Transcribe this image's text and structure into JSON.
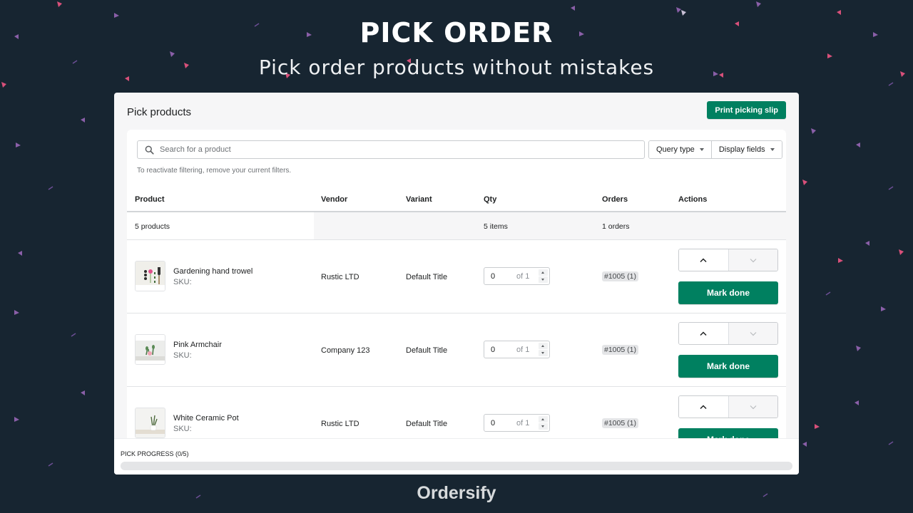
{
  "hero": {
    "title": "PICK ORDER",
    "subtitle": "Pick order products without mistakes"
  },
  "brand": "Ordersify",
  "colors": {
    "background": "#172531",
    "accent": "#008060",
    "confetti_purple": "#8a5fa8",
    "confetti_pink": "#d8507a"
  },
  "panel": {
    "title": "Pick products",
    "print_button": "Print picking slip"
  },
  "search": {
    "icon": "search-icon",
    "placeholder": "Search for a product",
    "value": ""
  },
  "filters": {
    "query_type": "Query type",
    "display_fields": "Display fields"
  },
  "hint": "To reactivate filtering, remove your current filters.",
  "table": {
    "headers": [
      "Product",
      "Vendor",
      "Variant",
      "Qty",
      "Orders",
      "Actions"
    ],
    "summary": {
      "products": "5 products",
      "items": "5 items",
      "orders": "1 orders"
    },
    "rows": [
      {
        "name": "Gardening hand trowel",
        "sku": "SKU:",
        "vendor": "Rustic LTD",
        "variant": "Default Title",
        "qty_value": "0",
        "qty_total": "of 1",
        "order_badge": "#1005 (1)",
        "mark_done": "Mark done",
        "thumb": "trowel"
      },
      {
        "name": "Pink Armchair",
        "sku": "SKU:",
        "vendor": "Company 123",
        "variant": "Default Title",
        "qty_value": "0",
        "qty_total": "of 1",
        "order_badge": "#1005 (1)",
        "mark_done": "Mark done",
        "thumb": "armchair"
      },
      {
        "name": "White Ceramic Pot",
        "sku": "SKU:",
        "vendor": "Rustic LTD",
        "variant": "Default Title",
        "qty_value": "0",
        "qty_total": "of 1",
        "order_badge": "#1005 (1)",
        "mark_done": "Mark done",
        "thumb": "pot"
      }
    ]
  },
  "progress": {
    "label": "PICK PROGRESS (0/5)",
    "done": 0,
    "total": 5,
    "fraction": 0
  }
}
